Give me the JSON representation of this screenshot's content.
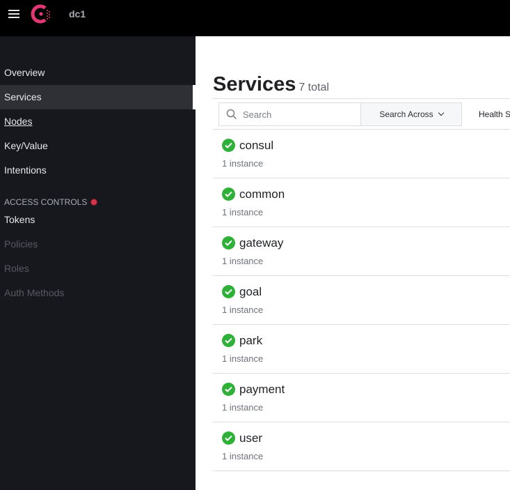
{
  "topbar": {
    "datacenter": "dc1",
    "brand_color": "#e03875"
  },
  "sidebar": {
    "items": [
      {
        "label": "Overview",
        "state": "normal"
      },
      {
        "label": "Services",
        "state": "active"
      },
      {
        "label": "Nodes",
        "state": "hover"
      },
      {
        "label": "Key/Value",
        "state": "normal"
      },
      {
        "label": "Intentions",
        "state": "normal"
      }
    ],
    "section_label": "ACCESS CONTROLS",
    "acl_items": [
      {
        "label": "Tokens",
        "state": "normal"
      },
      {
        "label": "Policies",
        "state": "disabled"
      },
      {
        "label": "Roles",
        "state": "disabled"
      },
      {
        "label": "Auth Methods",
        "state": "disabled"
      }
    ]
  },
  "main": {
    "title": "Services",
    "total": "7 total",
    "search": {
      "placeholder": "Search",
      "value": ""
    },
    "search_across": "Search Across",
    "health_status": "Health S",
    "services": [
      {
        "name": "consul",
        "instances": "1 instance",
        "status": "passing"
      },
      {
        "name": "common",
        "instances": "1 instance",
        "status": "passing"
      },
      {
        "name": "gateway",
        "instances": "1 instance",
        "status": "passing"
      },
      {
        "name": "goal",
        "instances": "1 instance",
        "status": "passing"
      },
      {
        "name": "park",
        "instances": "1 instance",
        "status": "passing"
      },
      {
        "name": "payment",
        "instances": "1 instance",
        "status": "passing"
      },
      {
        "name": "user",
        "instances": "1 instance",
        "status": "passing"
      }
    ]
  }
}
